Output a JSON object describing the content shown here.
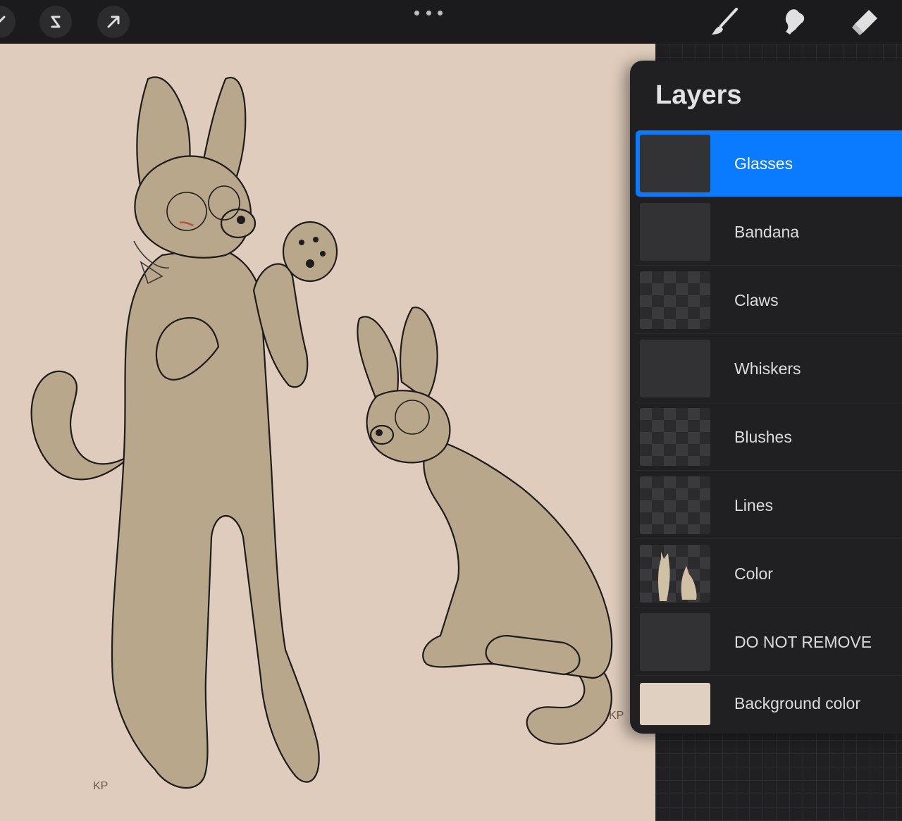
{
  "app": {
    "top_left_tools": [
      "adjustments-icon",
      "selection-icon",
      "transform-icon"
    ],
    "top_right_tools": [
      "brush-icon",
      "smudge-icon",
      "eraser-icon"
    ]
  },
  "canvas": {
    "background_color": "#dfccbc",
    "signature_left": "KP",
    "signature_right": "KP"
  },
  "layers_panel": {
    "title": "Layers",
    "layers": [
      {
        "name": "Glasses",
        "selected": true,
        "thumbnail": "glasses-thumbnail"
      },
      {
        "name": "Bandana",
        "selected": false,
        "thumbnail": "bandana-thumbnail"
      },
      {
        "name": "Claws",
        "selected": false,
        "thumbnail": "claws-thumbnail"
      },
      {
        "name": "Whiskers",
        "selected": false,
        "thumbnail": "whiskers-thumbnail"
      },
      {
        "name": "Blushes",
        "selected": false,
        "thumbnail": "blushes-thumbnail"
      },
      {
        "name": "Lines",
        "selected": false,
        "thumbnail": "lines-thumbnail"
      },
      {
        "name": "Color",
        "selected": false,
        "thumbnail": "color-thumbnail"
      },
      {
        "name": "DO NOT REMOVE",
        "selected": false,
        "thumbnail": "blank-thumbnail"
      },
      {
        "name": "Background color",
        "selected": false,
        "thumbnail": "background-color-swatch"
      }
    ]
  },
  "colors": {
    "accent": "#0a7aff",
    "panel_bg": "#202022",
    "fur": "#b9a78c",
    "line": "#1c1c1c"
  }
}
